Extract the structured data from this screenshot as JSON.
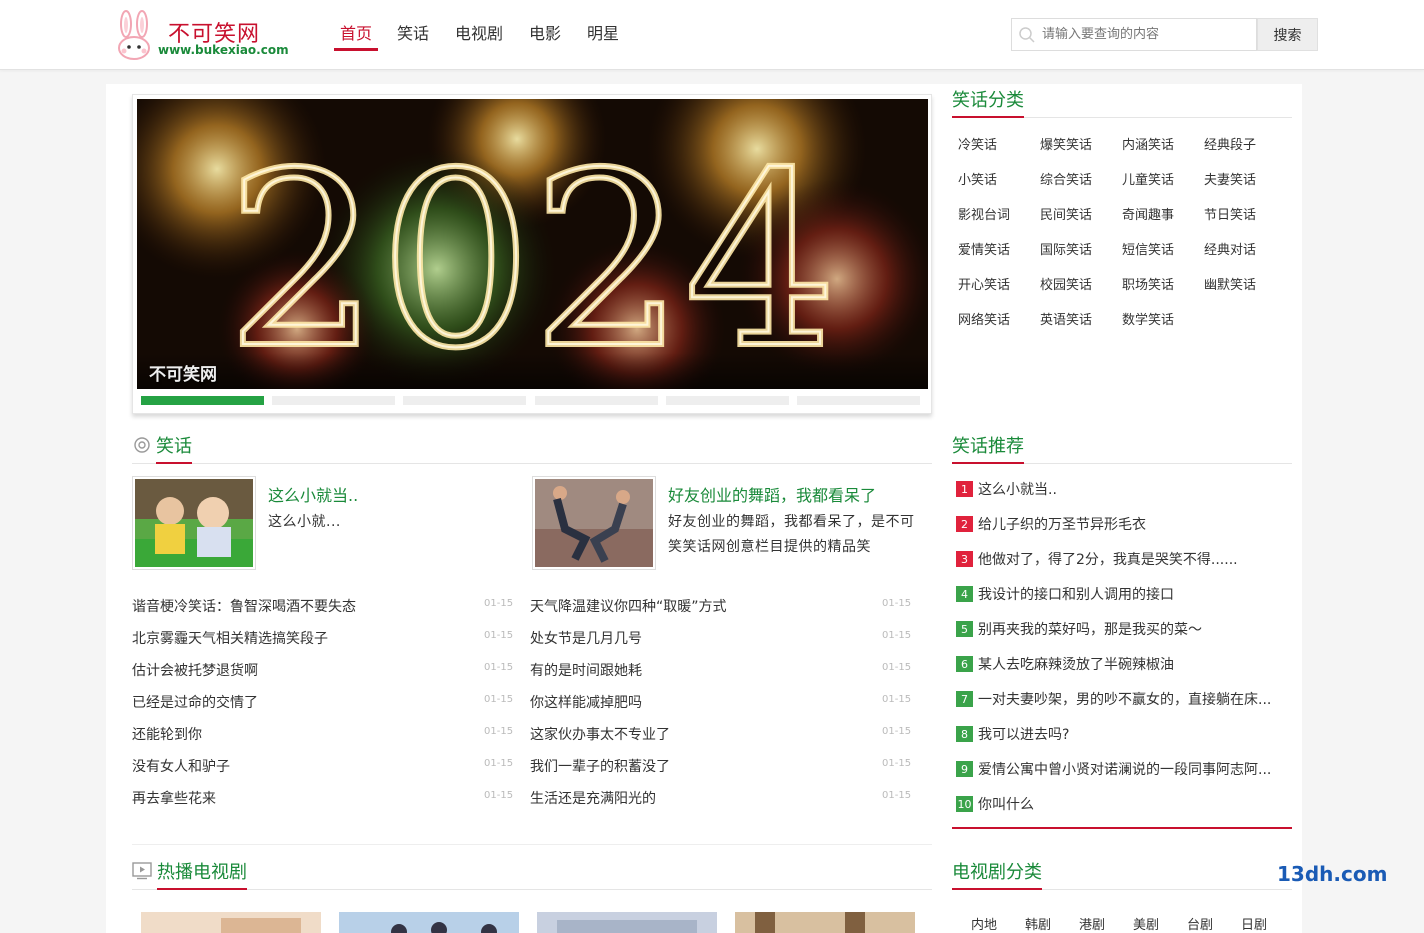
{
  "header": {
    "logo_title": "不可笑网",
    "logo_url": "www.bukexiao.com",
    "nav": [
      "首页",
      "笑话",
      "电视剧",
      "电影",
      "明星"
    ],
    "active_nav": 0,
    "search_placeholder": "请输入要查询的内容",
    "search_button": "搜索",
    "accent_color": "#c8102e",
    "green_color": "#1a8a3a"
  },
  "slider": {
    "image_text": "2024",
    "watermark": "不可笑网",
    "slide_count": 6,
    "active_slide": 0
  },
  "joke_categories": {
    "title": "笑话分类",
    "items": [
      "冷笑话",
      "爆笑笑话",
      "内涵笑话",
      "经典段子",
      "小笑话",
      "综合笑话",
      "儿童笑话",
      "夫妻笑话",
      "影视台词",
      "民间笑话",
      "奇闻趣事",
      "节日笑话",
      "爱情笑话",
      "国际笑话",
      "短信笑话",
      "经典对话",
      "开心笑话",
      "校园笑话",
      "职场笑话",
      "幽默笑话",
      "网络笑话",
      "英语笑话",
      "数学笑话"
    ]
  },
  "jokes": {
    "title": "笑话",
    "featured": [
      {
        "title": "这么小就当..",
        "desc": "这么小就..."
      },
      {
        "title": "好友创业的舞蹈，我都看呆了",
        "desc": "好友创业的舞蹈，我都看呆了，是不可笑笑话网创意栏目提供的精品笑"
      }
    ],
    "left_list": [
      {
        "title": "谐音梗冷笑话：鲁智深喝酒不要失态",
        "date": "01-15"
      },
      {
        "title": "北京雾霾天气相关精选搞笑段子",
        "date": "01-15"
      },
      {
        "title": "估计会被托梦退货啊",
        "date": "01-15"
      },
      {
        "title": "已经是过命的交情了",
        "date": "01-15"
      },
      {
        "title": "还能轮到你",
        "date": "01-15"
      },
      {
        "title": "没有女人和驴子",
        "date": "01-15"
      },
      {
        "title": "再去拿些花来",
        "date": "01-15"
      }
    ],
    "right_list": [
      {
        "title": "天气降温建议你四种“取暖”方式",
        "date": "01-15"
      },
      {
        "title": "处女节是几月几号",
        "date": "01-15"
      },
      {
        "title": "有的是时间跟她耗",
        "date": "01-15"
      },
      {
        "title": "你这样能减掉肥吗",
        "date": "01-15"
      },
      {
        "title": "这家伙办事太不专业了",
        "date": "01-15"
      },
      {
        "title": "我们一辈子的积蓄没了",
        "date": "01-15"
      },
      {
        "title": "生活还是充满阳光的",
        "date": "01-15"
      }
    ]
  },
  "recommend": {
    "title": "笑话推荐",
    "items": [
      {
        "num": "1",
        "title": "这么小就当..",
        "color": "#e0223c"
      },
      {
        "num": "2",
        "title": "给儿子织的万圣节异形毛衣",
        "color": "#e0223c"
      },
      {
        "num": "3",
        "title": "他做对了，得了2分，我真是哭笑不得......",
        "color": "#e0223c"
      },
      {
        "num": "4",
        "title": "我设计的接口和别人调用的接口",
        "color": "#3aa34a"
      },
      {
        "num": "5",
        "title": "别再夹我的菜好吗，那是我买的菜～",
        "color": "#3aa34a"
      },
      {
        "num": "6",
        "title": "某人去吃麻辣烫放了半碗辣椒油",
        "color": "#3aa34a"
      },
      {
        "num": "7",
        "title": "一对夫妻吵架，男的吵不赢女的，直接躺在床...",
        "color": "#3aa34a"
      },
      {
        "num": "8",
        "title": "我可以进去吗?",
        "color": "#3aa34a"
      },
      {
        "num": "9",
        "title": "爱情公寓中曾小贤对诺澜说的一段同事阿志阿...",
        "color": "#3aa34a"
      },
      {
        "num": "10",
        "title": "你叫什么",
        "color": "#3aa34a"
      }
    ]
  },
  "tv": {
    "title": "热播电视剧",
    "categories_title": "电视剧分类",
    "categories": [
      "内地",
      "韩剧",
      "港剧",
      "美剧",
      "台剧",
      "日剧"
    ]
  },
  "watermark_brand": "13dh.com"
}
